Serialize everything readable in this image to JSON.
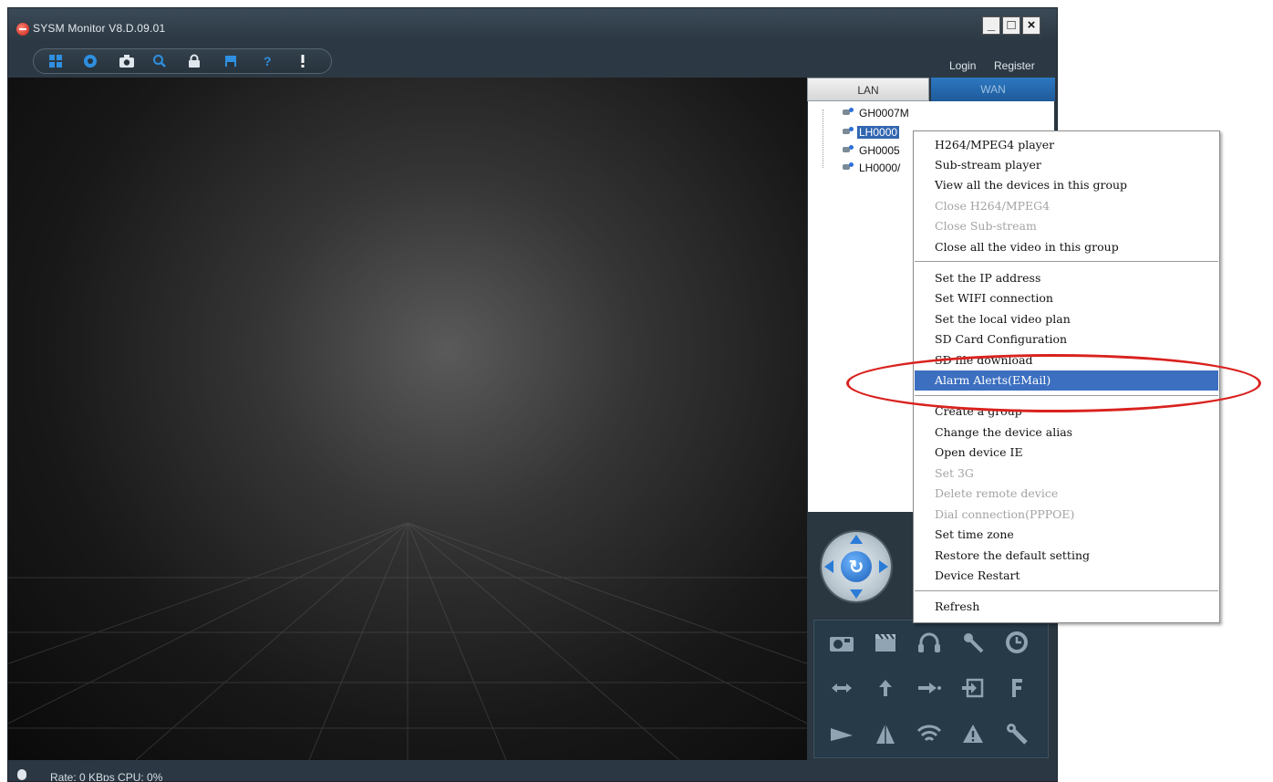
{
  "window": {
    "title": "SYSM Monitor  V8.D.09.01",
    "minimize": "_",
    "maximize": "□",
    "close": "×"
  },
  "toolbar": {
    "login": "Login",
    "register": "Register",
    "icons": [
      "grid-icon",
      "settings-icon",
      "camera-icon",
      "search-icon",
      "lock-icon",
      "save-icon",
      "help-icon",
      "info-icon"
    ]
  },
  "panel": {
    "tabs": [
      {
        "label": "LAN",
        "active": true
      },
      {
        "label": "WAN",
        "active": false
      }
    ],
    "devices": [
      {
        "label": "GH0007M",
        "selected": false
      },
      {
        "label": "LH0000",
        "selected": true
      },
      {
        "label": "GH0005",
        "selected": false
      },
      {
        "label": "LH0000/",
        "selected": false
      }
    ],
    "ptz_center": "↻",
    "controls": [
      "snapshot-icon",
      "record-icon",
      "audio-icon",
      "talk-icon",
      "clock-icon",
      "swap-horizontal-icon",
      "arrow-up-icon",
      "arrow-right-icon",
      "enter-icon",
      "focus-icon",
      "play-icon",
      "pyramid-icon",
      "wifi-icon",
      "warning-icon",
      "wrench-icon"
    ]
  },
  "context_menu": {
    "items": [
      {
        "label": "H264/MPEG4 player",
        "enabled": true
      },
      {
        "label": "Sub-stream player",
        "enabled": true
      },
      {
        "label": "View all the devices in this group",
        "enabled": true
      },
      {
        "label": "Close H264/MPEG4",
        "enabled": false
      },
      {
        "label": "Close Sub-stream",
        "enabled": false
      },
      {
        "label": "Close all the video in this group",
        "enabled": true
      },
      {
        "separator": true
      },
      {
        "label": "Set the IP address",
        "enabled": true
      },
      {
        "label": "Set WIFI connection",
        "enabled": true
      },
      {
        "label": "Set the local video plan",
        "enabled": true
      },
      {
        "label": "SD Card Configuration",
        "enabled": true
      },
      {
        "label": "SD file download",
        "enabled": true
      },
      {
        "label": "Alarm Alerts(EMail)",
        "enabled": true,
        "highlighted": true
      },
      {
        "separator": true
      },
      {
        "label": "Create a group",
        "enabled": true
      },
      {
        "label": "Change the device alias",
        "enabled": true
      },
      {
        "label": "Open device IE",
        "enabled": true
      },
      {
        "label": "Set 3G",
        "enabled": false
      },
      {
        "label": "Delete remote device",
        "enabled": false
      },
      {
        "label": "Dial connection(PPPOE)",
        "enabled": false
      },
      {
        "label": "Set time zone",
        "enabled": true
      },
      {
        "label": "Restore the default setting",
        "enabled": true
      },
      {
        "label": "Device Restart",
        "enabled": true
      },
      {
        "separator": true
      },
      {
        "label": "Refresh",
        "enabled": true
      }
    ]
  },
  "status": {
    "text": "Rate: 0 KBps  CPU:  0%"
  },
  "colors": {
    "highlight": "#3c6fc0",
    "annotation": "#d9221e",
    "toolbar_icon": "#2f8fe0"
  }
}
